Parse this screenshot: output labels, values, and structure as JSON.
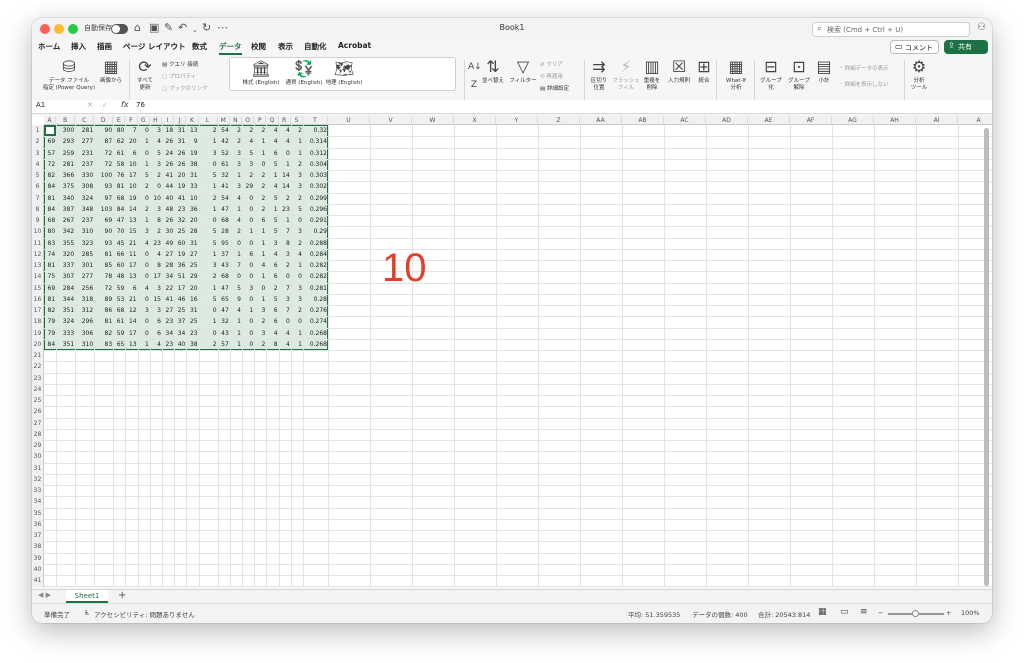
{
  "titlebar": {
    "autosave": "自動保存",
    "book_title": "Book1",
    "search_placeholder": "検索 (Cmd + Ctrl + U)"
  },
  "tabs": [
    "ホーム",
    "挿入",
    "描画",
    "ページ レイアウト",
    "数式",
    "データ",
    "校閲",
    "表示",
    "自動化",
    "Acrobat"
  ],
  "active_tab": "データ",
  "comment_label": "コメント",
  "share_label": "共有",
  "ribbon": {
    "get_data": "データ ファイル\n指定 (Power Query)",
    "from_image": "画像から",
    "refresh_all": "すべて\n更新",
    "queries": "クエリ",
    "connections": "接続",
    "properties": "プロパティ",
    "book_links": "ブックのリンク",
    "stocks": "株式 (English)",
    "currencies": "通貨 (English)",
    "geography": "地理 (English)",
    "sort": "並べ替え",
    "filter": "フィルター",
    "clear": "クリア",
    "reapply": "再適用",
    "advanced": "詳細設定",
    "text_to_columns": "区切り\n位置",
    "flash_fill": "フラッシュ\nフィル",
    "remove_dups": "重複を\n削除",
    "data_validation": "入力規則",
    "consolidate": "統合",
    "what_if": "What-If\n分析",
    "group": "グループ\n化",
    "ungroup": "グループ\n解除",
    "subtotal": "小計",
    "show_detail": "詳細データの表示",
    "hide_detail": "詳細を表示しない",
    "analysis": "分析\nツール"
  },
  "formula_bar": {
    "name_box": "A1",
    "formula": "76"
  },
  "columns": [
    "A",
    "B",
    "C",
    "D",
    "E",
    "F",
    "G",
    "H",
    "I",
    "J",
    "K",
    "L",
    "M",
    "N",
    "O",
    "P",
    "Q",
    "R",
    "S",
    "T",
    "U",
    "V",
    "W",
    "X",
    "Y",
    "Z",
    "AA",
    "AB",
    "AC",
    "AD",
    "AE",
    "AF",
    "AG",
    "AH",
    "AI",
    "A"
  ],
  "row_count": 41,
  "cells": [
    [
      "76",
      "300",
      "281",
      "90",
      "80",
      "7",
      "0",
      "3",
      "18",
      "31",
      "13",
      "2",
      "54",
      "2",
      "2",
      "2",
      "4",
      "4",
      "2",
      "0.32"
    ],
    [
      "69",
      "293",
      "277",
      "87",
      "62",
      "20",
      "1",
      "4",
      "26",
      "31",
      "9",
      "1",
      "42",
      "2",
      "4",
      "1",
      "4",
      "4",
      "1",
      "0.314"
    ],
    [
      "57",
      "259",
      "231",
      "72",
      "61",
      "6",
      "0",
      "5",
      "24",
      "26",
      "19",
      "3",
      "52",
      "3",
      "5",
      "1",
      "6",
      "0",
      "1",
      "0.312"
    ],
    [
      "72",
      "281",
      "237",
      "72",
      "58",
      "10",
      "1",
      "3",
      "26",
      "26",
      "38",
      "0",
      "61",
      "3",
      "3",
      "0",
      "5",
      "1",
      "2",
      "0.304"
    ],
    [
      "82",
      "366",
      "330",
      "100",
      "76",
      "17",
      "5",
      "2",
      "41",
      "20",
      "31",
      "5",
      "32",
      "1",
      "2",
      "2",
      "1",
      "14",
      "3",
      "0.303"
    ],
    [
      "84",
      "375",
      "308",
      "93",
      "81",
      "10",
      "2",
      "0",
      "44",
      "19",
      "33",
      "1",
      "41",
      "3",
      "29",
      "2",
      "4",
      "14",
      "3",
      "0.302"
    ],
    [
      "81",
      "340",
      "324",
      "97",
      "68",
      "19",
      "0",
      "10",
      "40",
      "41",
      "10",
      "2",
      "54",
      "4",
      "0",
      "2",
      "5",
      "2",
      "2",
      "0.299"
    ],
    [
      "84",
      "387",
      "348",
      "103",
      "84",
      "14",
      "2",
      "3",
      "48",
      "23",
      "36",
      "1",
      "47",
      "1",
      "0",
      "2",
      "1",
      "23",
      "5",
      "0.296"
    ],
    [
      "68",
      "267",
      "237",
      "69",
      "47",
      "13",
      "1",
      "8",
      "26",
      "32",
      "20",
      "0",
      "68",
      "4",
      "0",
      "6",
      "5",
      "1",
      "0",
      "0.291"
    ],
    [
      "80",
      "342",
      "310",
      "90",
      "70",
      "15",
      "3",
      "2",
      "30",
      "25",
      "28",
      "5",
      "28",
      "2",
      "1",
      "1",
      "5",
      "7",
      "3",
      "0.29"
    ],
    [
      "83",
      "355",
      "323",
      "93",
      "45",
      "21",
      "4",
      "23",
      "49",
      "60",
      "31",
      "5",
      "95",
      "0",
      "0",
      "1",
      "3",
      "8",
      "2",
      "0.288"
    ],
    [
      "74",
      "320",
      "285",
      "81",
      "66",
      "11",
      "0",
      "4",
      "27",
      "19",
      "27",
      "1",
      "37",
      "1",
      "6",
      "1",
      "4",
      "3",
      "4",
      "0.284"
    ],
    [
      "81",
      "337",
      "301",
      "85",
      "60",
      "17",
      "0",
      "8",
      "28",
      "36",
      "25",
      "3",
      "43",
      "7",
      "0",
      "4",
      "6",
      "2",
      "1",
      "0.282"
    ],
    [
      "75",
      "307",
      "277",
      "78",
      "48",
      "13",
      "0",
      "17",
      "34",
      "51",
      "29",
      "2",
      "68",
      "0",
      "0",
      "1",
      "6",
      "0",
      "0",
      "0.282"
    ],
    [
      "69",
      "284",
      "256",
      "72",
      "59",
      "6",
      "4",
      "3",
      "22",
      "17",
      "20",
      "1",
      "47",
      "5",
      "3",
      "0",
      "2",
      "7",
      "3",
      "0.281"
    ],
    [
      "81",
      "344",
      "318",
      "89",
      "53",
      "21",
      "0",
      "15",
      "41",
      "46",
      "16",
      "5",
      "65",
      "9",
      "0",
      "1",
      "5",
      "3",
      "3",
      "0.28"
    ],
    [
      "82",
      "351",
      "312",
      "86",
      "68",
      "12",
      "3",
      "3",
      "27",
      "25",
      "31",
      "0",
      "47",
      "4",
      "1",
      "3",
      "6",
      "7",
      "2",
      "0.276"
    ],
    [
      "79",
      "324",
      "296",
      "81",
      "61",
      "14",
      "0",
      "6",
      "23",
      "37",
      "25",
      "1",
      "32",
      "1",
      "0",
      "2",
      "6",
      "0",
      "0",
      "0.274"
    ],
    [
      "79",
      "333",
      "306",
      "82",
      "59",
      "17",
      "0",
      "6",
      "34",
      "34",
      "23",
      "0",
      "43",
      "1",
      "0",
      "3",
      "4",
      "4",
      "1",
      "0.268"
    ],
    [
      "84",
      "351",
      "310",
      "83",
      "65",
      "13",
      "1",
      "4",
      "23",
      "40",
      "38",
      "2",
      "57",
      "1",
      "0",
      "2",
      "8",
      "4",
      "1",
      "0.268"
    ]
  ],
  "overlay_text": "10",
  "sheet": {
    "tab_name": "Sheet1",
    "add": "+"
  },
  "status": {
    "ready": "準備完了",
    "accessibility": "アクセシビリティ: 問題ありません",
    "average": "平均: 51.359535",
    "count": "データの個数: 400",
    "sum": "合計: 20543.814",
    "zoom": "100%"
  }
}
